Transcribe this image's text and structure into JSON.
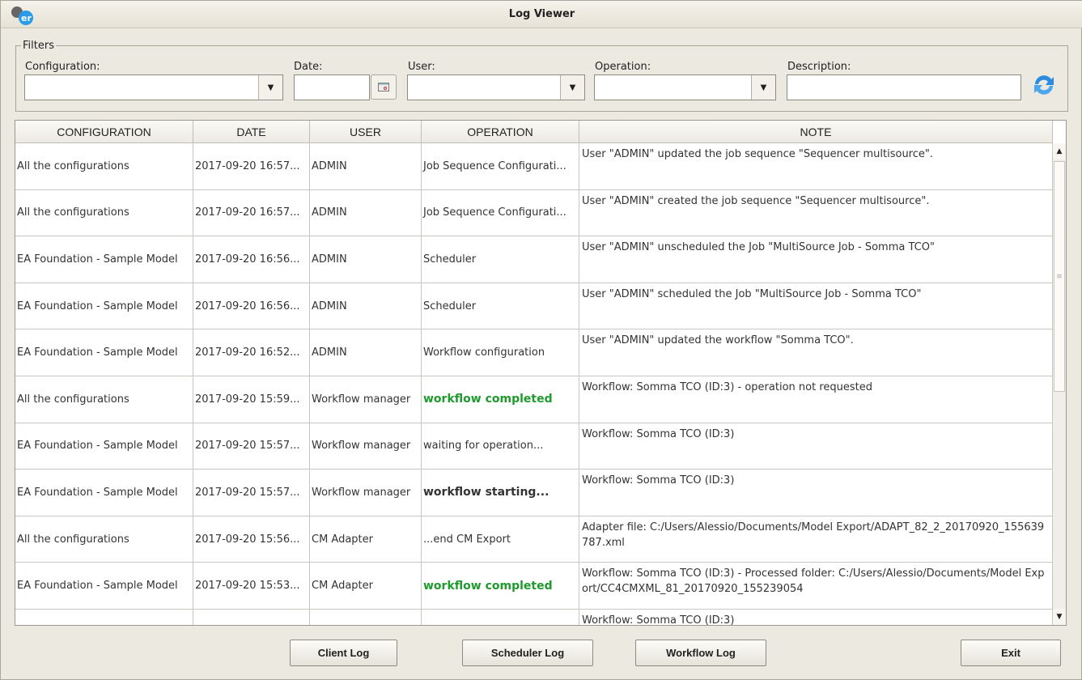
{
  "window": {
    "title": "Log Viewer",
    "logo_text": "er"
  },
  "filters": {
    "legend": "Filters",
    "configuration_label": "Configuration:",
    "configuration_value": "",
    "date_label": "Date:",
    "date_value": "",
    "user_label": "User:",
    "user_value": "",
    "operation_label": "Operation:",
    "operation_value": "",
    "description_label": "Description:",
    "description_value": ""
  },
  "table": {
    "columns": [
      "CONFIGURATION",
      "DATE",
      "USER",
      "OPERATION",
      "NOTE"
    ],
    "rows": [
      {
        "configuration": "All the configurations",
        "date": "2017-09-20 16:57...",
        "user": "ADMIN",
        "operation": "Job Sequence Configurati...",
        "style": "",
        "note": "User \"ADMIN\" updated the job sequence \"Sequencer multisource\"."
      },
      {
        "configuration": "All the configurations",
        "date": "2017-09-20 16:57...",
        "user": "ADMIN",
        "operation": "Job Sequence Configurati...",
        "style": "",
        "note": "User \"ADMIN\" created the job sequence \"Sequencer multisource\"."
      },
      {
        "configuration": "EA Foundation - Sample Model",
        "date": "2017-09-20 16:56...",
        "user": "ADMIN",
        "operation": "Scheduler",
        "style": "",
        "note": "User \"ADMIN\" unscheduled the Job \"MultiSource Job - Somma TCO\""
      },
      {
        "configuration": "EA Foundation - Sample Model",
        "date": "2017-09-20 16:56...",
        "user": "ADMIN",
        "operation": "Scheduler",
        "style": "",
        "note": "User \"ADMIN\" scheduled the Job \"MultiSource Job - Somma TCO\""
      },
      {
        "configuration": "EA Foundation - Sample Model",
        "date": "2017-09-20 16:52...",
        "user": "ADMIN",
        "operation": "Workflow configuration",
        "style": "",
        "note": "User \"ADMIN\" updated the workflow \"Somma TCO\"."
      },
      {
        "configuration": "All the configurations",
        "date": "2017-09-20 15:59...",
        "user": "Workflow manager",
        "operation": "workflow completed",
        "style": "green",
        "note": "Workflow: Somma TCO (ID:3) - operation not requested"
      },
      {
        "configuration": "EA Foundation - Sample Model",
        "date": "2017-09-20 15:57...",
        "user": "Workflow manager",
        "operation": "waiting for operation...",
        "style": "",
        "note": "Workflow: Somma TCO (ID:3)"
      },
      {
        "configuration": "EA Foundation - Sample Model",
        "date": "2017-09-20 15:57...",
        "user": "Workflow manager",
        "operation": "workflow starting...",
        "style": "bold",
        "note": "Workflow: Somma TCO (ID:3)"
      },
      {
        "configuration": "All the configurations",
        "date": "2017-09-20 15:56...",
        "user": "CM Adapter",
        "operation": "...end CM Export",
        "style": "",
        "note": "Adapter file: C:/Users/Alessio/Documents/Model Export/ADAPT_82_2_20170920_155639787.xml"
      },
      {
        "configuration": "EA Foundation - Sample Model",
        "date": "2017-09-20 15:53...",
        "user": "CM Adapter",
        "operation": "workflow completed",
        "style": "green",
        "note": "Workflow: Somma TCO (ID:3) - Processed folder: C:/Users/Alessio/Documents/Model Export/CC4CMXML_81_20170920_155239054"
      },
      {
        "configuration": "",
        "date": "",
        "user": "",
        "operation": "",
        "style": "",
        "note": "Workflow: Somma TCO (ID:3)"
      }
    ]
  },
  "buttons": {
    "client_log": "Client Log",
    "scheduler_log": "Scheduler Log",
    "workflow_log": "Workflow Log",
    "exit": "Exit"
  },
  "colors": {
    "success": "#1f9a2c",
    "refresh_icon": "#2a8be0"
  }
}
